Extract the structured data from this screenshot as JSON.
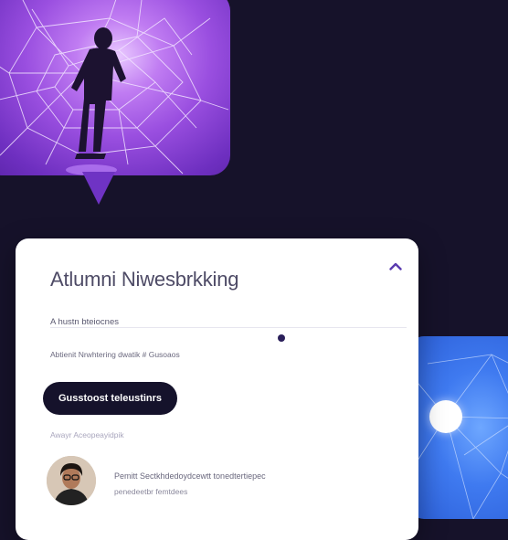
{
  "card": {
    "title": "Atlumni Niwesbrkking",
    "field_label": "A hustn bteiocnes",
    "description": "Abtienit Nrwhtering dwatik # Gusoaos",
    "cta_label": "Gusstoost teleustinrs",
    "note": "Awayr Aceopeayidpik",
    "person_line1": "Pemitt Sectkhdedoydcewtt tonedtertiepec",
    "person_line2": "penedeetbr femtdees"
  },
  "icons": {
    "collapse": "chevron-up-icon",
    "avatar": "user-avatar"
  },
  "colors": {
    "background": "#16122a",
    "hero_purple": "#9a4fe0",
    "side_blue": "#3f7af0",
    "cta": "#15122b",
    "card": "#ffffff"
  }
}
